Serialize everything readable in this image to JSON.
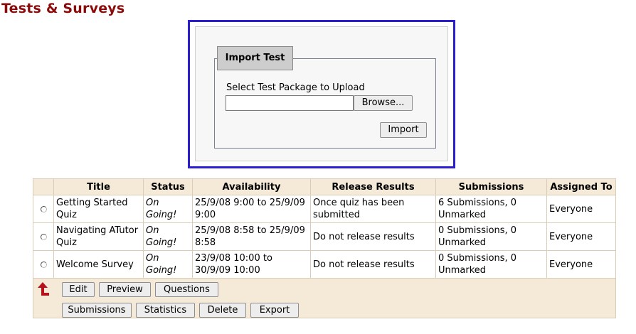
{
  "page": {
    "title": "Tests & Surveys"
  },
  "import_panel": {
    "legend": "Import Test",
    "label": "Select Test Package to Upload",
    "file_value": "",
    "browse_label": "Browse...",
    "import_label": "Import"
  },
  "table": {
    "headers": [
      "Title",
      "Status",
      "Availability",
      "Release Results",
      "Submissions",
      "Assigned To"
    ],
    "rows": [
      {
        "title": "Getting Started Quiz",
        "status": "On Going!",
        "availability": "25/9/08 9:00 to 25/9/09 9:00",
        "release": "Once quiz has been submitted",
        "submissions": "6 Submissions, 0 Unmarked",
        "assigned": "Everyone"
      },
      {
        "title": "Navigating ATutor Quiz",
        "status": "On Going!",
        "availability": "25/9/08 8:58 to 25/9/09 8:58",
        "release": "Do not release results",
        "submissions": "0 Submissions, 0 Unmarked",
        "assigned": "Everyone"
      },
      {
        "title": "Welcome Survey",
        "status": "On Going!",
        "availability": "23/9/08 10:00 to 30/9/09 10:00",
        "release": "Do not release results",
        "submissions": "0 Submissions, 0 Unmarked",
        "assigned": "Everyone"
      }
    ]
  },
  "actions": {
    "row1": [
      "Edit",
      "Preview",
      "Questions"
    ],
    "row2": [
      "Submissions",
      "Statistics",
      "Delete",
      "Export"
    ],
    "icon": "arrow-up-left-icon"
  },
  "colors": {
    "title": "#8b0b0b",
    "frame_border": "#2a1ecf",
    "table_header_bg": "#f5ead7",
    "arrow_icon": "#b5121b"
  }
}
